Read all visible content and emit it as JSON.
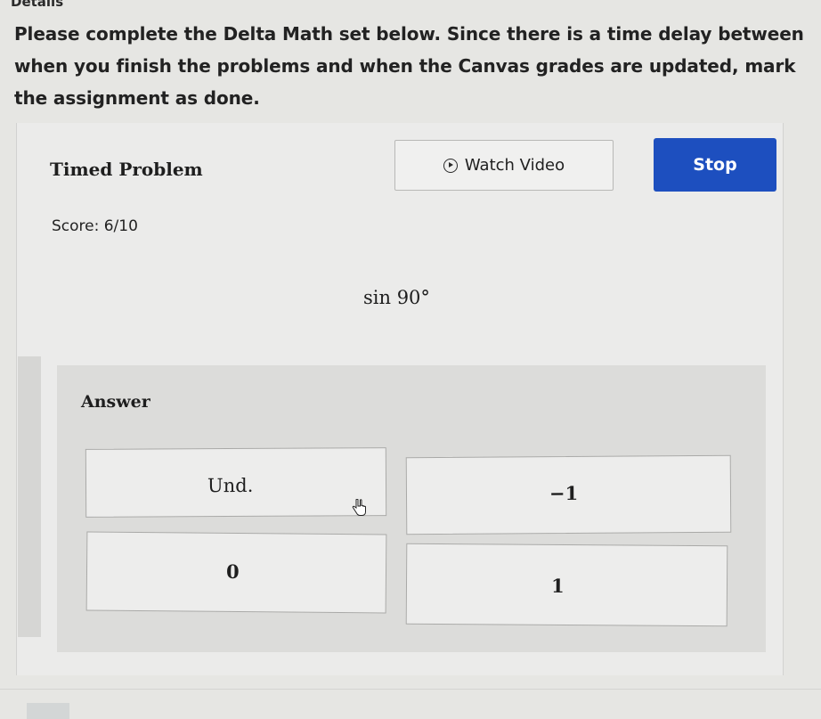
{
  "header": {
    "details_label": "Details"
  },
  "description": {
    "text": "Please complete the Delta Math set below. Since there is a time delay between when you finish the problems and when the Canvas grades are updated, mark the assignment as done."
  },
  "problem": {
    "title": "Timed Problem",
    "watch_video_label": "Watch Video",
    "stop_label": "Stop",
    "score": "Score: 6/10",
    "question": "sin 90°"
  },
  "answer": {
    "label": "Answer",
    "choices": [
      "Und.",
      "−1",
      "0",
      "1"
    ]
  },
  "colors": {
    "stop_button": "#1d4fbf",
    "background": "#e6e6e3"
  },
  "icons": {
    "video": "play-circle-icon",
    "cursor": "hand-pointer-icon"
  }
}
